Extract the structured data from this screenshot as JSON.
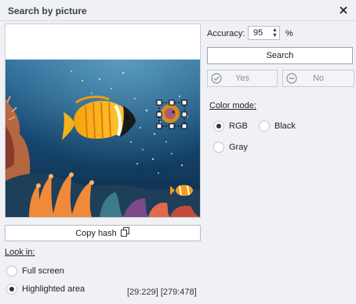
{
  "window": {
    "title": "Search by picture"
  },
  "copy_hash": {
    "label": "Copy hash"
  },
  "look_in": {
    "label": "Look in:",
    "options": [
      {
        "label": "Full screen",
        "selected": false
      },
      {
        "label": "Highlighted area",
        "selected": true
      }
    ],
    "coords": "[29:229] [279:478]"
  },
  "accuracy": {
    "label": "Accuracy:",
    "value": "95",
    "unit": "%"
  },
  "search": {
    "label": "Search"
  },
  "yes_button": {
    "label": "Yes",
    "enabled": false
  },
  "no_button": {
    "label": "No",
    "enabled": false
  },
  "color_mode": {
    "label": "Color mode:",
    "options": [
      {
        "label": "RGB",
        "selected": true
      },
      {
        "label": "Black",
        "selected": false
      },
      {
        "label": "Gray",
        "selected": false
      }
    ]
  },
  "icons": {
    "close": "close-icon",
    "copy": "copy-icon",
    "yes": "check-circle-icon",
    "no": "minus-circle-icon"
  },
  "colors": {
    "background": "#f0f1f5",
    "selection_handles": "#ffffff",
    "selection_border": "#000000"
  }
}
